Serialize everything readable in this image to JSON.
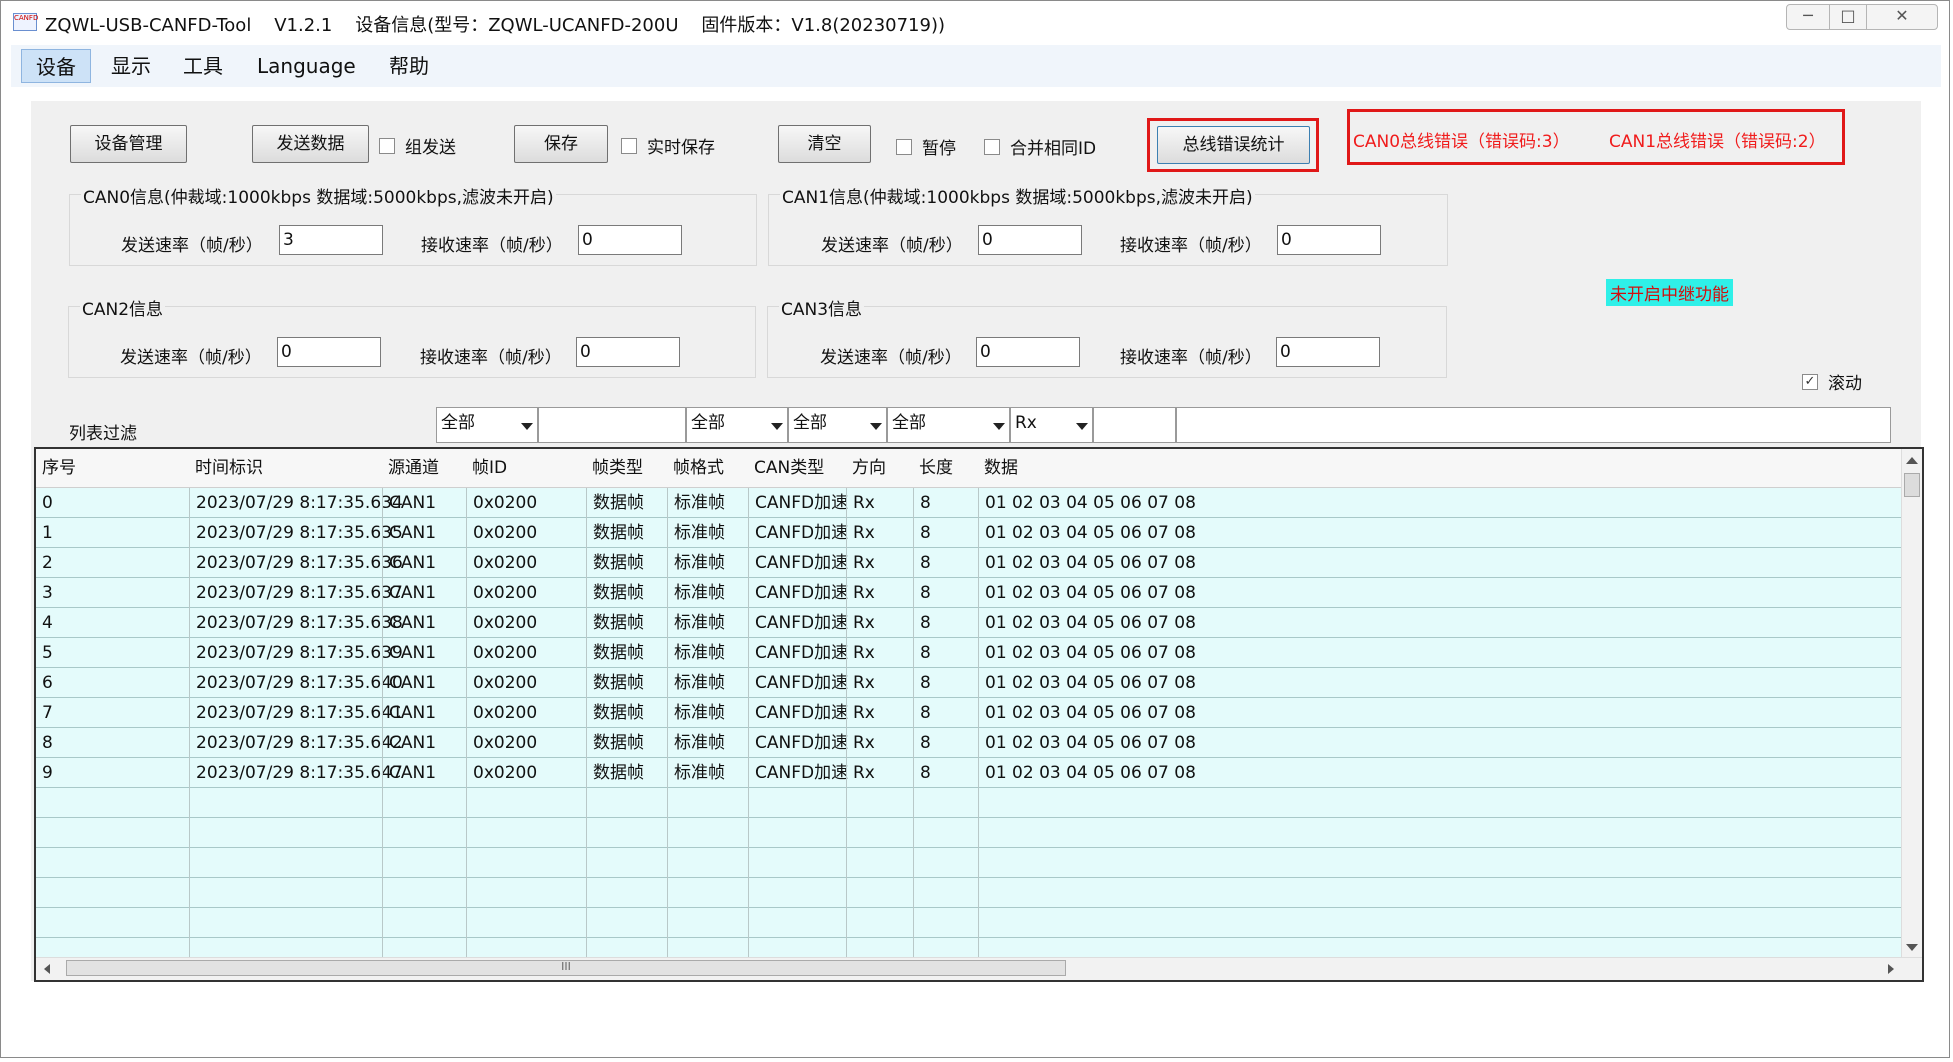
{
  "window": {
    "app_icon_text": "CANFD",
    "title": "ZQWL-USB-CANFD-Tool    V1.2.1    设备信息(型号：ZQWL-UCANFD-200U    固件版本：V1.8(20230719))"
  },
  "menu": [
    "设备",
    "显示",
    "工具",
    "Language",
    "帮助"
  ],
  "toolbar": {
    "device_mgmt": "设备管理",
    "send_data": "发送数据",
    "group_send": "组发送",
    "save": "保存",
    "realtime_save": "实时保存",
    "clear": "清空",
    "pause": "暂停",
    "merge_id": "合并相同ID",
    "bus_error_stats": "总线错误统计"
  },
  "bus_errors": {
    "can0": "CAN0总线错误（错误码:3）",
    "can1": "CAN1总线错误（错误码:2）"
  },
  "groups": [
    {
      "title": "CAN0信息(仲裁域:1000kbps   数据域:5000kbps,滤波未开启)",
      "send_label": "发送速率（帧/秒）",
      "send_value": "3",
      "recv_label": "接收速率（帧/秒）",
      "recv_value": "0"
    },
    {
      "title": "CAN1信息(仲裁域:1000kbps   数据域:5000kbps,滤波未开启)",
      "send_label": "发送速率（帧/秒）",
      "send_value": "0",
      "recv_label": "接收速率（帧/秒）",
      "recv_value": "0"
    },
    {
      "title": "CAN2信息",
      "send_label": "发送速率（帧/秒）",
      "send_value": "0",
      "recv_label": "接收速率（帧/秒）",
      "recv_value": "0"
    },
    {
      "title": "CAN3信息",
      "send_label": "发送速率（帧/秒）",
      "send_value": "0",
      "recv_label": "接收速率（帧/秒）",
      "recv_value": "0"
    }
  ],
  "relay_status": "未开启中继功能",
  "scroll": {
    "label": "滚动",
    "checked": true
  },
  "filter": {
    "label": "列表过滤",
    "channel": "全部",
    "frame_type": "全部",
    "frame_format": "全部",
    "can_type": "全部",
    "direction": "Rx"
  },
  "table": {
    "columns": [
      "序号",
      "时间标识",
      "源通道",
      "帧ID",
      "帧类型",
      "帧格式",
      "CAN类型",
      "方向",
      "长度",
      "数据"
    ],
    "rows": [
      [
        "0",
        "2023/07/29 8:17:35.634",
        "CAN1",
        "0x0200",
        "数据帧",
        "标准帧",
        "CANFD加速",
        "Rx",
        "8",
        "01 02 03 04 05 06 07 08"
      ],
      [
        "1",
        "2023/07/29 8:17:35.635",
        "CAN1",
        "0x0200",
        "数据帧",
        "标准帧",
        "CANFD加速",
        "Rx",
        "8",
        "01 02 03 04 05 06 07 08"
      ],
      [
        "2",
        "2023/07/29 8:17:35.636",
        "CAN1",
        "0x0200",
        "数据帧",
        "标准帧",
        "CANFD加速",
        "Rx",
        "8",
        "01 02 03 04 05 06 07 08"
      ],
      [
        "3",
        "2023/07/29 8:17:35.637",
        "CAN1",
        "0x0200",
        "数据帧",
        "标准帧",
        "CANFD加速",
        "Rx",
        "8",
        "01 02 03 04 05 06 07 08"
      ],
      [
        "4",
        "2023/07/29 8:17:35.638",
        "CAN1",
        "0x0200",
        "数据帧",
        "标准帧",
        "CANFD加速",
        "Rx",
        "8",
        "01 02 03 04 05 06 07 08"
      ],
      [
        "5",
        "2023/07/29 8:17:35.639",
        "CAN1",
        "0x0200",
        "数据帧",
        "标准帧",
        "CANFD加速",
        "Rx",
        "8",
        "01 02 03 04 05 06 07 08"
      ],
      [
        "6",
        "2023/07/29 8:17:35.640",
        "CAN1",
        "0x0200",
        "数据帧",
        "标准帧",
        "CANFD加速",
        "Rx",
        "8",
        "01 02 03 04 05 06 07 08"
      ],
      [
        "7",
        "2023/07/29 8:17:35.641",
        "CAN1",
        "0x0200",
        "数据帧",
        "标准帧",
        "CANFD加速",
        "Rx",
        "8",
        "01 02 03 04 05 06 07 08"
      ],
      [
        "8",
        "2023/07/29 8:17:35.642",
        "CAN1",
        "0x0200",
        "数据帧",
        "标准帧",
        "CANFD加速",
        "Rx",
        "8",
        "01 02 03 04 05 06 07 08"
      ],
      [
        "9",
        "2023/07/29 8:17:35.647",
        "CAN1",
        "0x0200",
        "数据帧",
        "标准帧",
        "CANFD加速",
        "Rx",
        "8",
        "01 02 03 04 05 06 07 08"
      ],
      [
        "",
        "",
        "",
        "",
        "",
        "",
        "",
        "",
        "",
        ""
      ],
      [
        "",
        "",
        "",
        "",
        "",
        "",
        "",
        "",
        "",
        ""
      ],
      [
        "",
        "",
        "",
        "",
        "",
        "",
        "",
        "",
        "",
        ""
      ],
      [
        "",
        "",
        "",
        "",
        "",
        "",
        "",
        "",
        "",
        ""
      ],
      [
        "",
        "",
        "",
        "",
        "",
        "",
        "",
        "",
        "",
        ""
      ],
      [
        "",
        "",
        "",
        "",
        "",
        "",
        "",
        "",
        "",
        ""
      ]
    ]
  },
  "hscroll_grip": "III",
  "colors": {
    "error_red": "#e01818",
    "relay_bg": "#2ff0e8",
    "row_bg": "#e4fbfb"
  }
}
